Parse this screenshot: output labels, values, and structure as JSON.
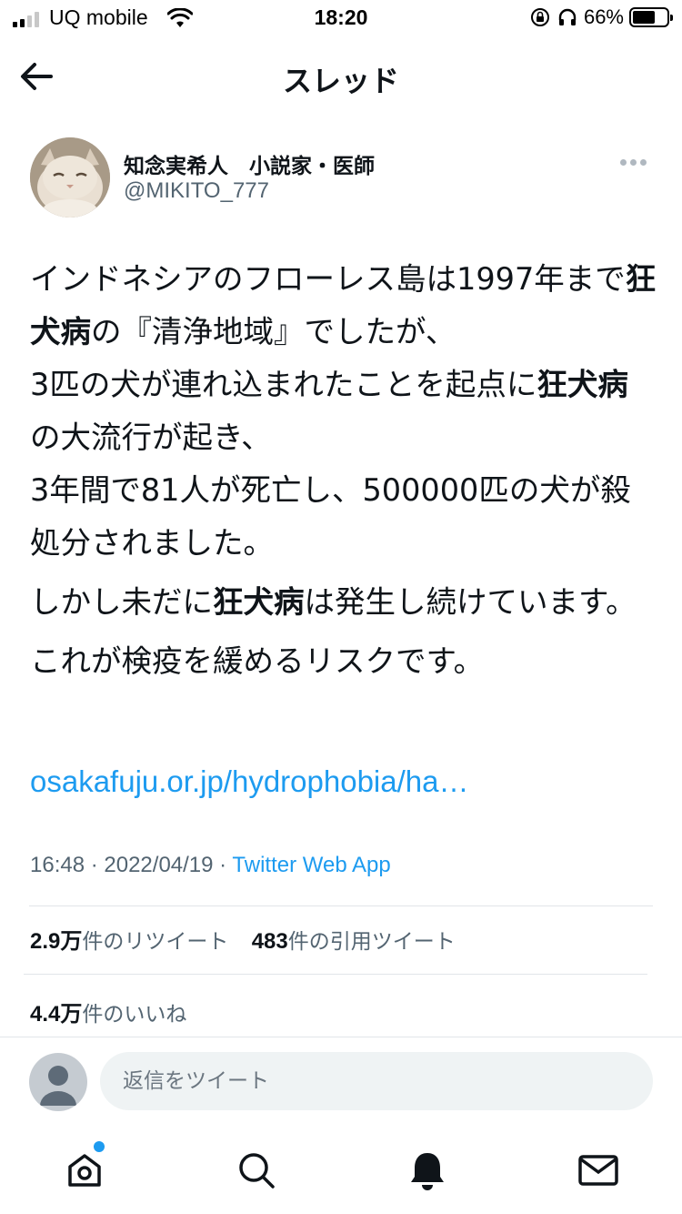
{
  "status_bar": {
    "carrier": "UQ mobile",
    "time": "18:20",
    "battery_percent": "66%",
    "battery_level": 0.66
  },
  "header": {
    "title": "スレッド",
    "back_icon": "arrow-left-icon"
  },
  "tweet": {
    "author_name": "知念実希人　小説家・医師",
    "author_handle": "@MIKITO_777",
    "body": {
      "p1": {
        "s1": "インドネシアのフローレス島は1997年まで",
        "b1": "狂犬病",
        "s2": "の『清浄地域』でしたが、",
        "s3": "3匹の犬が連れ込まれたことを起点に",
        "b2": "狂犬病",
        "s4": "の大流行が起き、",
        "s5": "3年間で81人が死亡し、500000匹の犬が殺処分されました。"
      },
      "p2": {
        "s1": "しかし未だに",
        "b1": "狂犬病",
        "s2": "は発生し続けています。"
      },
      "p3": "これが検疫を緩めるリスクです。"
    },
    "link": "osakafuju.or.jp/hydrophobia/ha…",
    "timestamp": "16:48 · 2022/04/19 · ",
    "source": "Twitter Web App",
    "stats": {
      "retweets_count": "2.9万",
      "retweets_label": "件のリツイート",
      "quotes_count": "483",
      "quotes_label": "件の引用ツイート",
      "likes_count": "4.4万",
      "likes_label": "件のいいね"
    }
  },
  "reply": {
    "placeholder": "返信をツイート"
  },
  "tabs": [
    {
      "icon": "home-icon"
    },
    {
      "icon": "search-icon"
    },
    {
      "icon": "bell-icon"
    },
    {
      "icon": "mail-icon"
    }
  ],
  "colors": {
    "accent": "#1d9bf0",
    "text": "#0f1419",
    "secondary": "#536471",
    "reply_bg": "#eff3f4"
  }
}
